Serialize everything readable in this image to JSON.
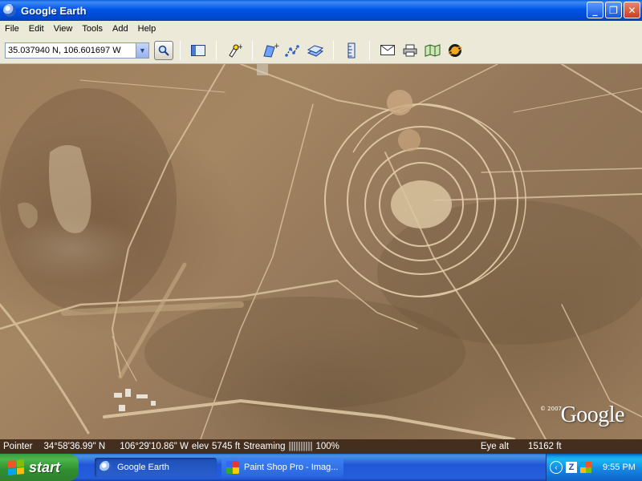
{
  "window": {
    "title": "Google Earth",
    "minimize": "_",
    "maximize": "❐",
    "close": "✕"
  },
  "menu": [
    "File",
    "Edit",
    "View",
    "Tools",
    "Add",
    "Help"
  ],
  "toolbar": {
    "coordinates": "35.037940 N, 106.601697 W",
    "icons": [
      "search-icon",
      "sidebar-icon",
      "placemark-icon",
      "polygon-icon",
      "path-icon",
      "image-overlay-icon",
      "ruler-icon",
      "email-icon",
      "print-icon",
      "maps-icon",
      "sky-icon"
    ]
  },
  "map": {
    "logo": "Google",
    "copyright": "© 2007"
  },
  "status": {
    "pointer_label": "Pointer",
    "lat": "34°58'36.99\" N",
    "lon": "106°29'10.86\" W",
    "elev_label": "elev",
    "elev": "5745 ft",
    "streaming_label": "Streaming",
    "streaming_bars": "||||||||||",
    "streaming_pct": "100%",
    "eye_label": "Eye alt",
    "eye_alt": "15162 ft"
  },
  "taskbar": {
    "start": "start",
    "tasks": [
      {
        "label": "Google Earth",
        "icon": "google-earth-icon"
      },
      {
        "label": "Paint Shop Pro - Imag...",
        "icon": "paint-shop-pro-icon"
      }
    ],
    "clock": "9:55 PM"
  }
}
